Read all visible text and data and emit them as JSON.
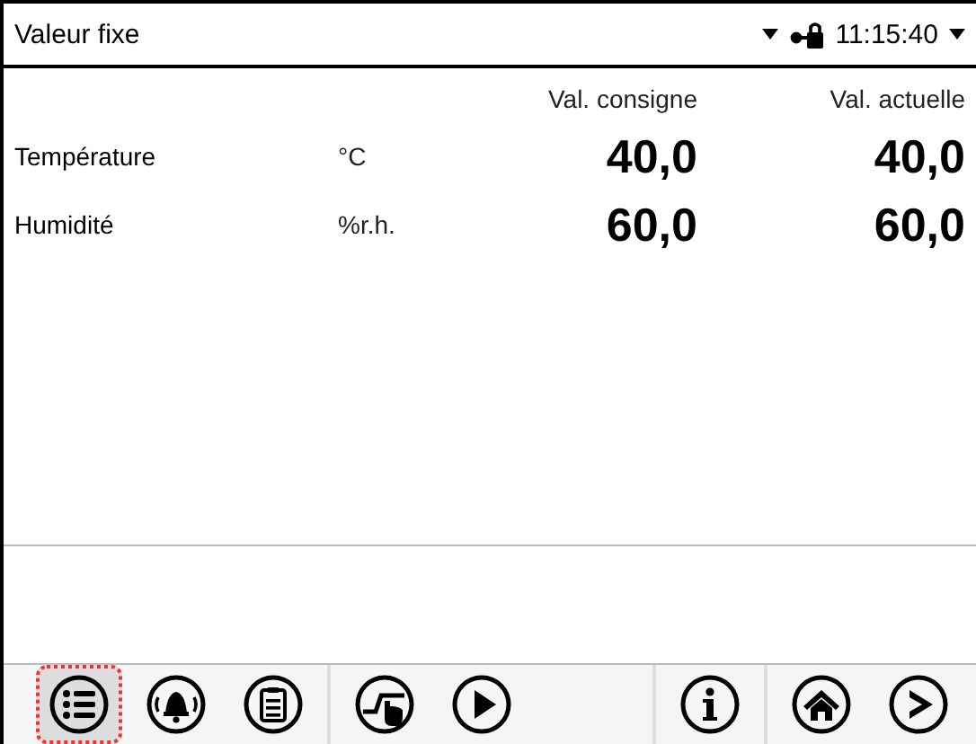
{
  "header": {
    "title": "Valeur fixe",
    "time": "11:15:40",
    "locked": true
  },
  "table": {
    "columns": [
      "Val. consigne",
      "Val. actuelle"
    ],
    "rows": [
      {
        "label": "Température",
        "unit": "°C",
        "setpoint": "40,0",
        "actual": "40,0"
      },
      {
        "label": "Humidité",
        "unit": "%r.h.",
        "setpoint": "60,0",
        "actual": "60,0"
      }
    ]
  },
  "toolbar": {
    "groups": [
      [
        {
          "kind": "menu",
          "selected": true
        },
        {
          "kind": "alarm",
          "selected": false
        },
        {
          "kind": "notes",
          "selected": false
        }
      ],
      [
        {
          "kind": "program",
          "selected": false
        },
        {
          "kind": "play",
          "selected": false
        }
      ],
      [
        {
          "kind": "info",
          "selected": false
        }
      ],
      [
        {
          "kind": "home",
          "selected": false
        },
        {
          "kind": "next",
          "selected": false
        }
      ]
    ]
  }
}
